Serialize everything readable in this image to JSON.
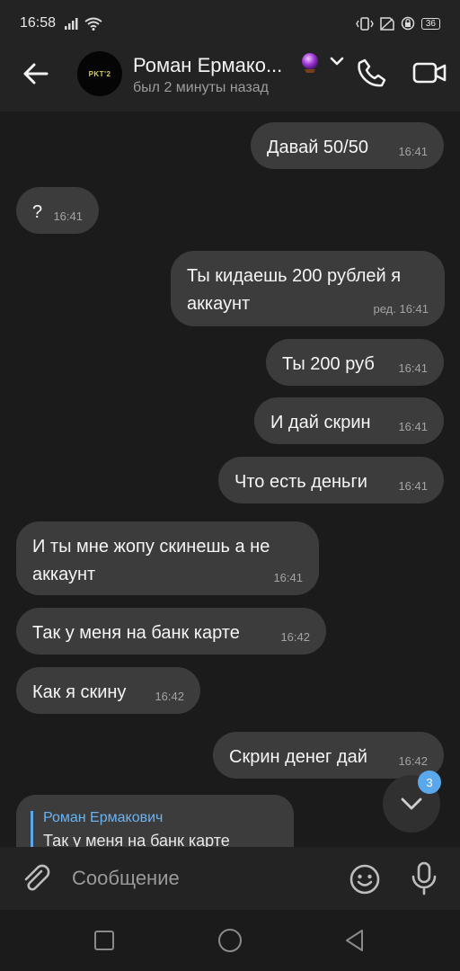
{
  "status_bar": {
    "time": "16:58",
    "battery": "36"
  },
  "header": {
    "avatar_text": "PKT'2",
    "contact_name": "Роман Ермако...",
    "status": "был 2 минуты назад"
  },
  "messages": [
    {
      "text": "Давай 50/50",
      "meta": "16:41",
      "outgoing": true
    },
    {
      "text": "?",
      "meta": "16:41",
      "outgoing": false
    },
    {
      "text": "Ты кидаешь 200 рублей я аккаунт",
      "meta": "ред. 16:41",
      "outgoing": true
    },
    {
      "text": "Ты 200 руб",
      "meta": "16:41",
      "outgoing": true
    },
    {
      "text": "И дай скрин",
      "meta": "16:41",
      "outgoing": true
    },
    {
      "text": "Что есть деньги",
      "meta": "16:41",
      "outgoing": true
    },
    {
      "text": "И ты мне жопу скинешь а не аккаунт",
      "meta": "16:41",
      "outgoing": false
    },
    {
      "text": "Так у меня на банк карте",
      "meta": "16:42",
      "outgoing": false
    },
    {
      "text": "Как я скину",
      "meta": "16:42",
      "outgoing": false
    },
    {
      "text": "Скрин денег дай",
      "meta": "16:42",
      "outgoing": true
    }
  ],
  "reply_preview": {
    "author": "Роман Ермакович",
    "text": "Так у меня на банк карте"
  },
  "scroll_button": {
    "unread_count": "3"
  },
  "composer": {
    "placeholder": "Сообщение"
  },
  "icons": {
    "back": "arrow-left-icon",
    "name_emoji": "crystal-ball-icon",
    "call": "phone-icon",
    "video": "video-camera-icon",
    "attach": "paperclip-icon",
    "emoji": "smiley-icon",
    "mic": "microphone-icon",
    "scroll_down": "chevron-down-icon"
  },
  "colors": {
    "background": "#1b1b1b",
    "bar": "#232323",
    "bubble": "#3c3c3c",
    "accent": "#5aa7ec",
    "reply_author": "#6ab3f3"
  }
}
